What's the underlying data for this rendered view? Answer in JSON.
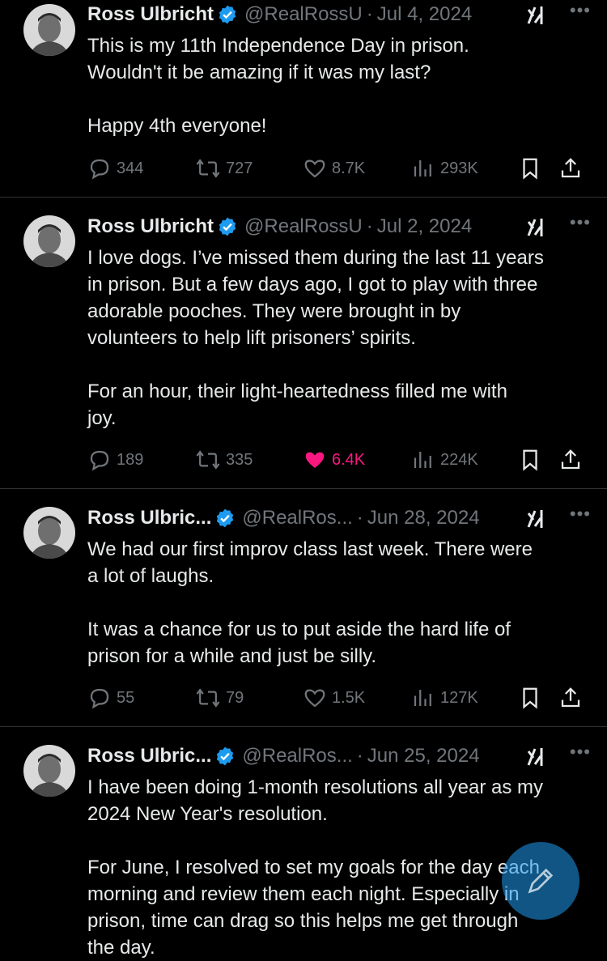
{
  "tweets": [
    {
      "name": "Ross Ulbricht",
      "handle": "@RealRossU",
      "date": "Jul 4, 2024",
      "text": "This is my 11th Independence Day in prison.\nWouldn't it be amazing if it was my last?\n\nHappy 4th everyone!",
      "replies": "344",
      "reposts": "727",
      "likes": "8.7K",
      "views": "293K",
      "liked": false
    },
    {
      "name": "Ross Ulbricht",
      "handle": "@RealRossU",
      "date": "Jul 2, 2024",
      "text": "I love dogs. I’ve missed them during the last 11 years\nin prison. But a few days ago, I got to play with three\nadorable pooches. They were brought in by\nvolunteers to help lift prisoners’ spirits.\n\nFor an hour, their light-heartedness filled me with\njoy.",
      "replies": "189",
      "reposts": "335",
      "likes": "6.4K",
      "views": "224K",
      "liked": true
    },
    {
      "name": "Ross Ulbric...",
      "handle": "@RealRos...",
      "date": "Jun 28, 2024",
      "text": "We had our first improv class last week. There were\na lot of laughs.\n\nIt was a chance for us to put aside the hard life of\nprison for a while and just be silly.",
      "replies": "55",
      "reposts": "79",
      "likes": "1.5K",
      "views": "127K",
      "liked": false
    },
    {
      "name": "Ross Ulbric...",
      "handle": "@RealRos...",
      "date": "Jun 25, 2024",
      "text": "I have been doing 1-month resolutions all year as my\n2024 New Year's resolution.\n\nFor June, I resolved to set my goals for the day each\nmorning and review them each night. Especially in\nprison, time can drag so this helps me get through\nthe day.",
      "liked": false
    }
  ],
  "colors": {
    "background": "#000000",
    "text": "#e7e9ea",
    "muted": "#71767b",
    "verified": "#1d9bf0",
    "like": "#f91880",
    "divider": "#2f3336"
  },
  "icons": [
    "reply-icon",
    "repost-icon",
    "like-icon",
    "views-icon",
    "bookmark-icon",
    "share-icon",
    "grok-icon",
    "more-icon",
    "verified-badge-icon",
    "compose-icon"
  ]
}
